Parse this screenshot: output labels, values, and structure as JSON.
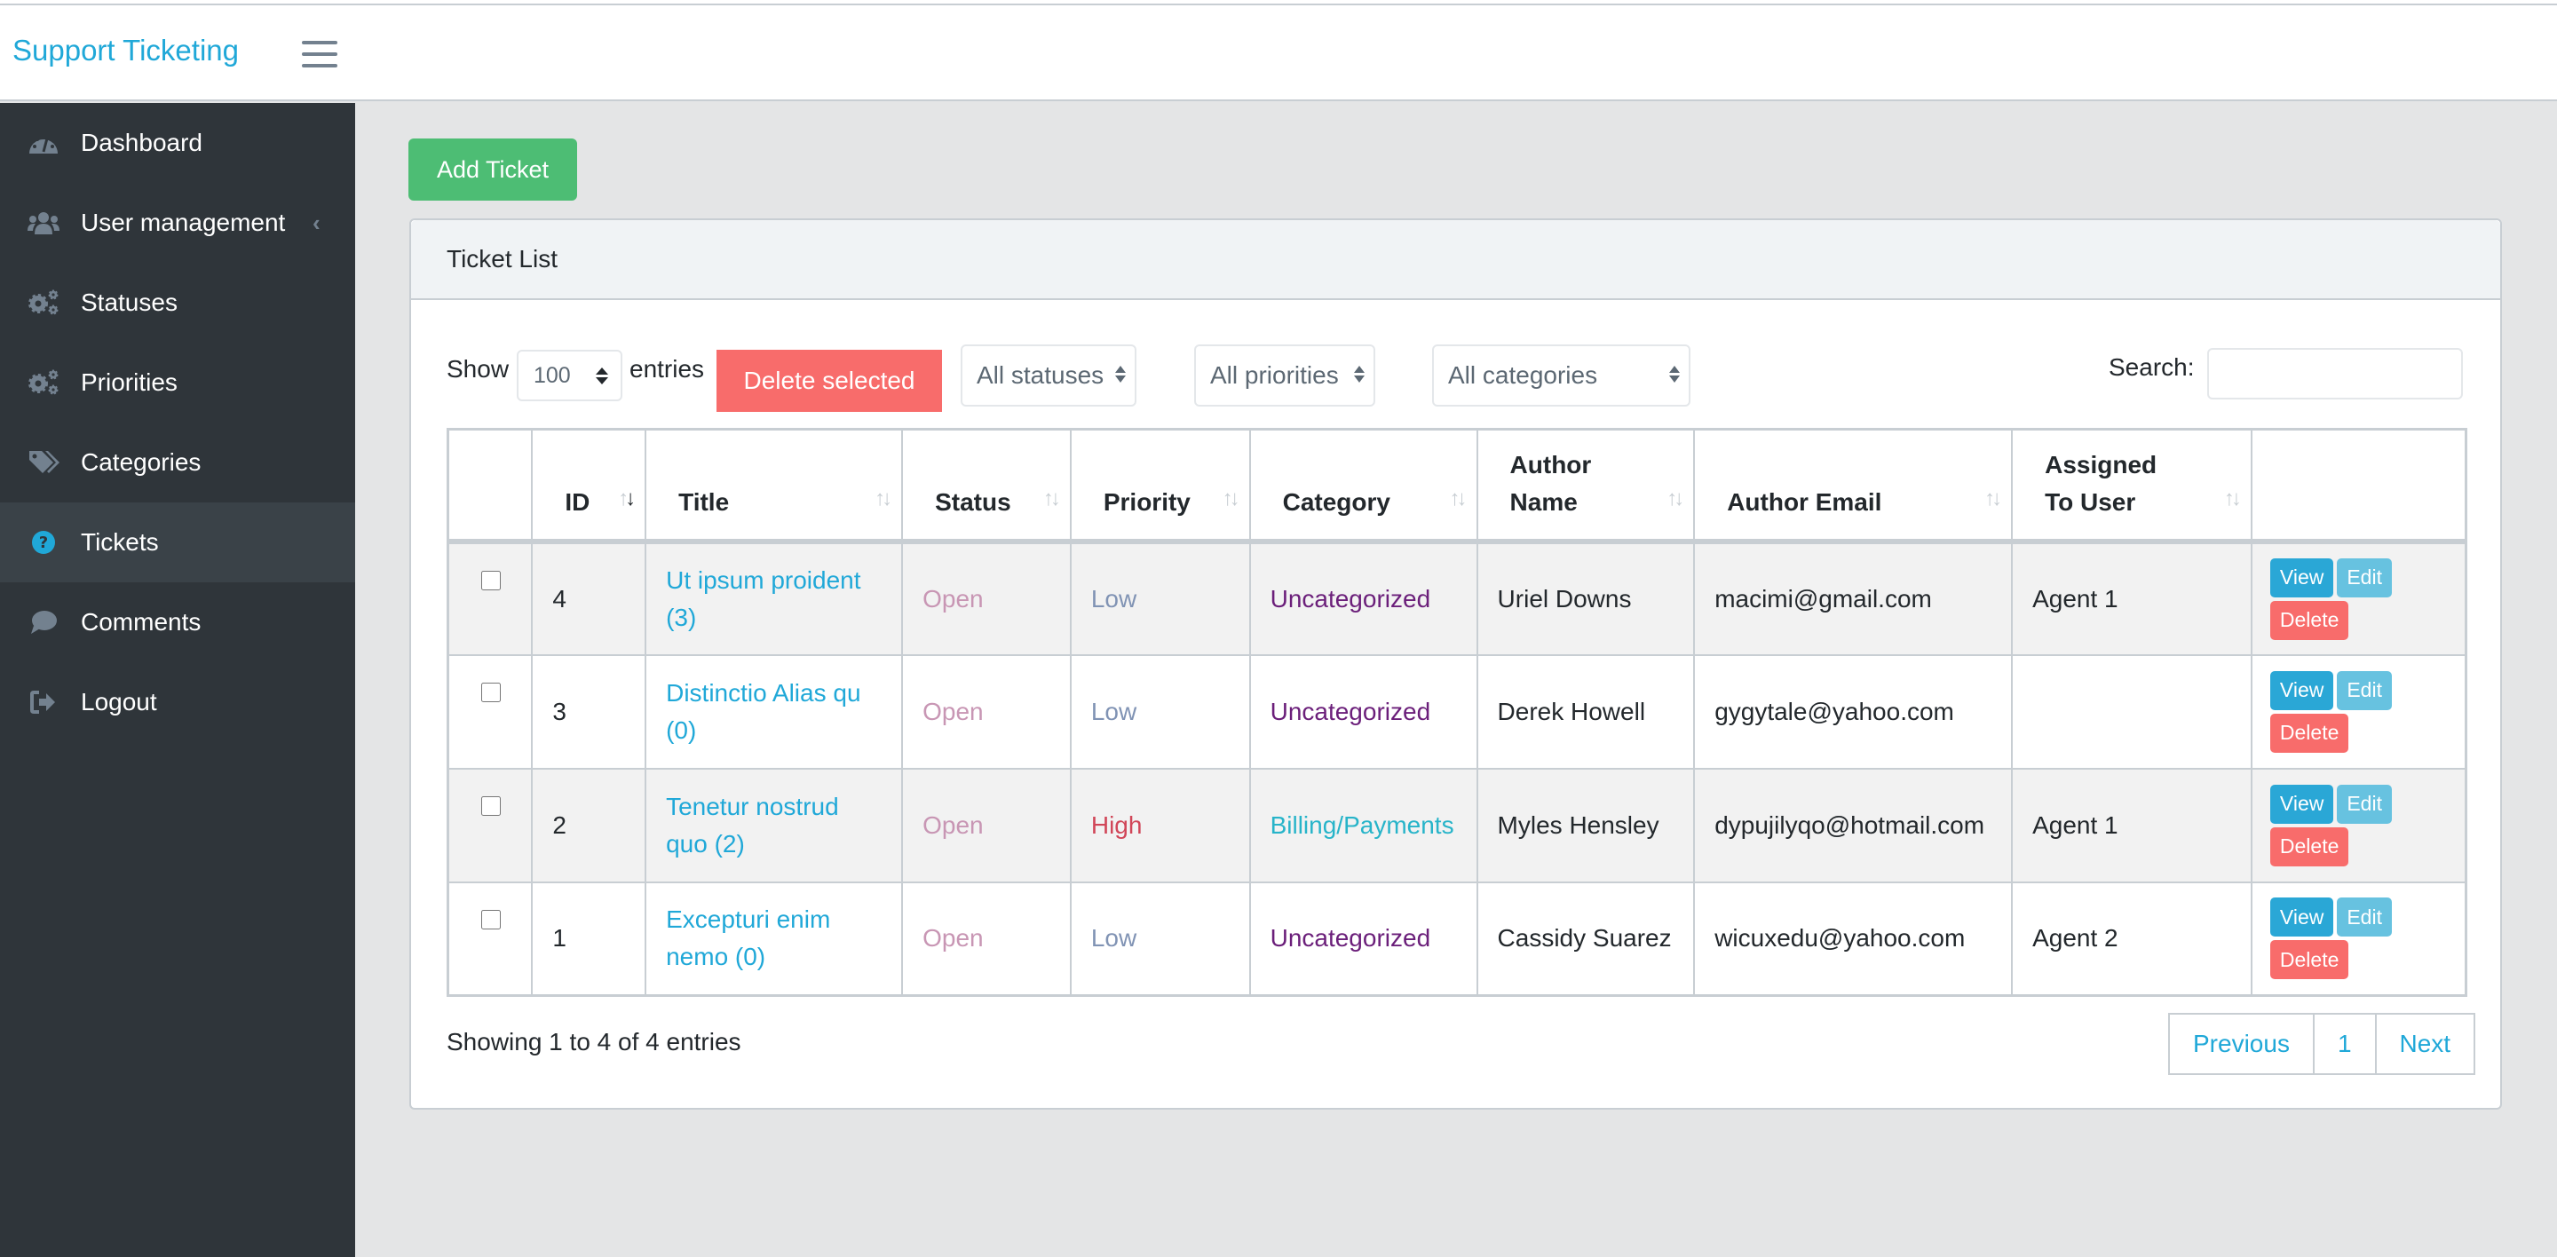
{
  "app": {
    "brand": "Support Ticketing",
    "menu_toggle_icon": "hamburger-icon"
  },
  "sidebar": {
    "items": [
      {
        "label": "Dashboard",
        "icon": "dashboard-gauge-icon",
        "active": false
      },
      {
        "label": "User management",
        "icon": "users-icon",
        "active": false,
        "has_submenu": true
      },
      {
        "label": "Statuses",
        "icon": "cogs-icon",
        "active": false
      },
      {
        "label": "Priorities",
        "icon": "cogs-icon",
        "active": false
      },
      {
        "label": "Categories",
        "icon": "tags-icon",
        "active": false
      },
      {
        "label": "Tickets",
        "icon": "question-circle-icon",
        "active": true
      },
      {
        "label": "Comments",
        "icon": "comment-icon",
        "active": false
      },
      {
        "label": "Logout",
        "icon": "sign-out-icon",
        "active": false
      }
    ],
    "submenu_chevron": "‹"
  },
  "toolbar": {
    "add_ticket_label": "Add Ticket"
  },
  "card": {
    "title": "Ticket List"
  },
  "controls": {
    "show_label": "Show",
    "page_length": "100",
    "entries_label": "entries",
    "delete_selected_label": "Delete selected",
    "status_filter": "All statuses",
    "priority_filter": "All priorities",
    "category_filter": "All categories",
    "search_label": "Search:",
    "search_value": ""
  },
  "table": {
    "columns": [
      "",
      "ID",
      "Title",
      "Status",
      "Priority",
      "Category",
      "Author Name",
      "Author Email",
      "Assigned To User",
      ""
    ],
    "sorted_column": "ID",
    "sort_direction": "desc",
    "rows": [
      {
        "id": "4",
        "title": "Ut ipsum proident (3)",
        "status": "Open",
        "priority": "Low",
        "category": "Uncategorized",
        "author_name": "Uriel Downs",
        "author_email": "macimi@gmail.com",
        "assigned_to": "Agent 1"
      },
      {
        "id": "3",
        "title": "Distinctio Alias qu (0)",
        "status": "Open",
        "priority": "Low",
        "category": "Uncategorized",
        "author_name": "Derek Howell",
        "author_email": "gygytale@yahoo.com",
        "assigned_to": ""
      },
      {
        "id": "2",
        "title": "Tenetur nostrud quo (2)",
        "status": "Open",
        "priority": "High",
        "category": "Billing/Payments",
        "author_name": "Myles Hensley",
        "author_email": "dypujilyqo@hotmail.com",
        "assigned_to": "Agent 1"
      },
      {
        "id": "1",
        "title": "Excepturi enim nemo (0)",
        "status": "Open",
        "priority": "Low",
        "category": "Uncategorized",
        "author_name": "Cassidy Suarez",
        "author_email": "wicuxedu@yahoo.com",
        "assigned_to": "Agent 2"
      }
    ],
    "actions": {
      "view": "View",
      "edit": "Edit",
      "delete": "Delete"
    }
  },
  "footer": {
    "info": "Showing 1 to 4 of 4 entries",
    "previous": "Previous",
    "current_page": "1",
    "next": "Next"
  },
  "colors": {
    "brand": "#20a8d8",
    "sidebar_bg": "#2f353a",
    "add_button": "#4dbd74",
    "danger": "#f86c6b",
    "status_open": "#c896b4",
    "priority_low": "#8093b4",
    "priority_high": "#d14658",
    "category_uncategorized": "#6b1f7a",
    "category_billing": "#27b4c9"
  }
}
